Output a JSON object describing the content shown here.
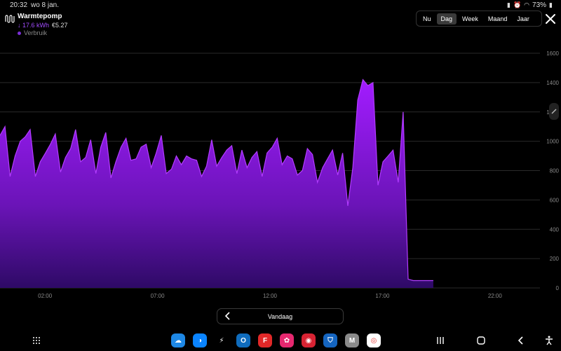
{
  "status": {
    "time": "20:32",
    "date": "wo 8 jan.",
    "battery": "73%"
  },
  "header": {
    "title": "Warmtepomp",
    "kwh": "↓ 17.6 kWh",
    "cost": "€5.27",
    "legend": "Verbruik",
    "accent": "#8b1fe0"
  },
  "segments": [
    {
      "label": "Nu",
      "active": false
    },
    {
      "label": "Dag",
      "active": true
    },
    {
      "label": "Week",
      "active": false
    },
    {
      "label": "Maand",
      "active": false
    },
    {
      "label": "Jaar",
      "active": false
    }
  ],
  "nav": {
    "label": "Vandaag"
  },
  "dock_apps": [
    {
      "name": "app-weather",
      "color": "#1e88e5",
      "glyph": "☁"
    },
    {
      "name": "app-clean",
      "color": "#0a84ff",
      "glyph": "◑"
    },
    {
      "name": "app-power",
      "color": "#000000",
      "glyph": "⚡"
    },
    {
      "name": "app-outlook",
      "color": "#0f6cbd",
      "glyph": "O"
    },
    {
      "name": "app-flipboard",
      "color": "#e12828",
      "glyph": "F"
    },
    {
      "name": "app-flower",
      "color": "#e6286f",
      "glyph": "✿"
    },
    {
      "name": "app-camera",
      "color": "#d82333",
      "glyph": "◉"
    },
    {
      "name": "app-shield",
      "color": "#1565c0",
      "glyph": "⛉"
    },
    {
      "name": "app-m",
      "color": "#8a8a8a",
      "glyph": "M"
    },
    {
      "name": "app-chrome",
      "color": "#ffffff",
      "glyph": "◎"
    }
  ],
  "chart_data": {
    "type": "area",
    "series": [
      {
        "name": "Verbruik",
        "color": "#8b1fe0",
        "x": [
          0,
          0.22,
          0.45,
          0.67,
          0.9,
          1.12,
          1.34,
          1.57,
          1.79,
          2.02,
          2.24,
          2.46,
          2.69,
          2.91,
          3.14,
          3.36,
          3.58,
          3.81,
          4.03,
          4.26,
          4.48,
          4.7,
          4.93,
          5.15,
          5.38,
          5.6,
          5.82,
          6.05,
          6.27,
          6.5,
          6.72,
          6.94,
          7.17,
          7.39,
          7.62,
          7.84,
          8.06,
          8.29,
          8.51,
          8.74,
          8.96,
          9.18,
          9.41,
          9.63,
          9.86,
          10.08,
          10.3,
          10.53,
          10.75,
          10.98,
          11.2,
          11.42,
          11.65,
          11.87,
          12.1,
          12.32,
          12.54,
          12.77,
          12.99,
          13.22,
          13.44,
          13.66,
          13.89,
          14.11,
          14.34,
          14.56,
          14.78,
          15.01,
          15.23,
          15.46,
          15.68,
          15.9,
          16.13,
          16.35,
          16.58,
          16.8,
          17.02,
          17.25,
          17.47,
          17.7,
          17.92,
          18.14,
          18.37,
          18.59,
          18.82,
          19.04,
          19.26,
          19.49,
          19.71,
          19.94,
          20.16,
          20.38,
          20.61,
          20.83,
          21.06,
          21.28,
          21.5,
          21.73,
          21.95,
          22.18,
          22.4,
          22.62,
          22.85,
          23.07,
          23.3,
          23.52,
          23.74,
          23.97
        ],
        "values": [
          1040,
          1100,
          760,
          900,
          1000,
          1030,
          1080,
          760,
          860,
          920,
          980,
          1050,
          790,
          890,
          950,
          1080,
          860,
          890,
          1010,
          780,
          960,
          1060,
          750,
          860,
          960,
          1020,
          870,
          880,
          960,
          980,
          820,
          920,
          1040,
          780,
          810,
          900,
          840,
          900,
          880,
          870,
          760,
          830,
          1010,
          830,
          890,
          940,
          970,
          780,
          940,
          820,
          890,
          930,
          760,
          920,
          960,
          1020,
          840,
          900,
          880,
          770,
          800,
          950,
          910,
          720,
          820,
          880,
          940,
          770,
          920,
          560,
          820,
          1280,
          1420,
          1380,
          1400,
          700,
          860,
          900,
          940,
          720,
          1200,
          60,
          50,
          50,
          50,
          50,
          50,
          null,
          null,
          null,
          null,
          null,
          null,
          null,
          null,
          null,
          null,
          null,
          null,
          null,
          null,
          null,
          null,
          null,
          null,
          null,
          null,
          null
        ],
        "note": "estimated shape"
      }
    ],
    "x_ticks": [
      "02:00",
      "07:00",
      "12:00",
      "17:00",
      "22:00"
    ],
    "x_tick_hours": [
      2,
      7,
      12,
      17,
      22
    ],
    "y_ticks": [
      0,
      200,
      400,
      600,
      800,
      1000,
      1200,
      1400,
      1600
    ],
    "ylim": [
      0,
      1600
    ],
    "xlim": [
      0,
      24
    ],
    "grid": true,
    "title": "",
    "xlabel": "",
    "ylabel": ""
  }
}
